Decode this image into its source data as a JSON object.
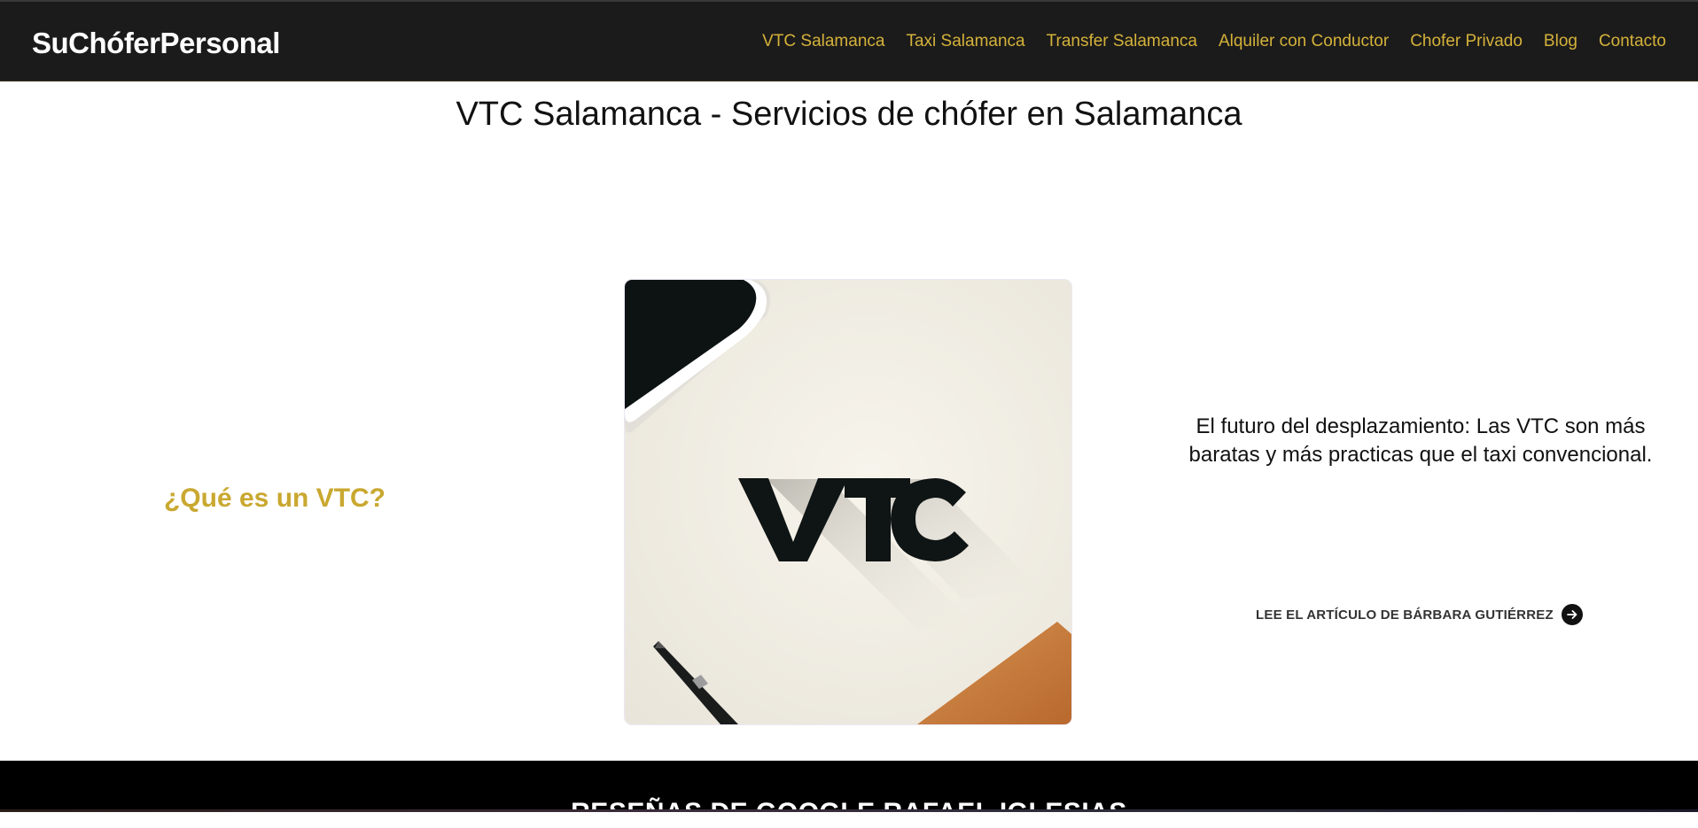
{
  "header": {
    "logo": "SuChóferPersonal",
    "nav": [
      {
        "label": "VTC Salamanca"
      },
      {
        "label": "Taxi Salamanca"
      },
      {
        "label": "Transfer Salamanca"
      },
      {
        "label": "Alquiler con Conductor"
      },
      {
        "label": "Chofer Privado"
      },
      {
        "label": "Blog"
      },
      {
        "label": "Contacto"
      }
    ]
  },
  "main": {
    "title": "VTC Salamanca - Servicios de chófer en Salamanca",
    "section_heading": "¿Qué es un VTC?",
    "image_text": "VTC",
    "excerpt": "El futuro del desplazamiento: Las VTC son más baratas y más practicas que el taxi convencional.",
    "read_more_label": "LEE EL ARTÍCULO DE BÁRBARA GUTIÉRREZ"
  },
  "reviews": {
    "title": "RESEÑAS DE GOOGLE RAFAEL IGLESIAS"
  },
  "icons": {
    "read_more": "arrow-right-circle-icon"
  },
  "colors": {
    "header_bg": "#1c1b1b",
    "nav_link": "#d4b23a",
    "heading_accent": "#c9a830",
    "band_bg": "#000000"
  }
}
